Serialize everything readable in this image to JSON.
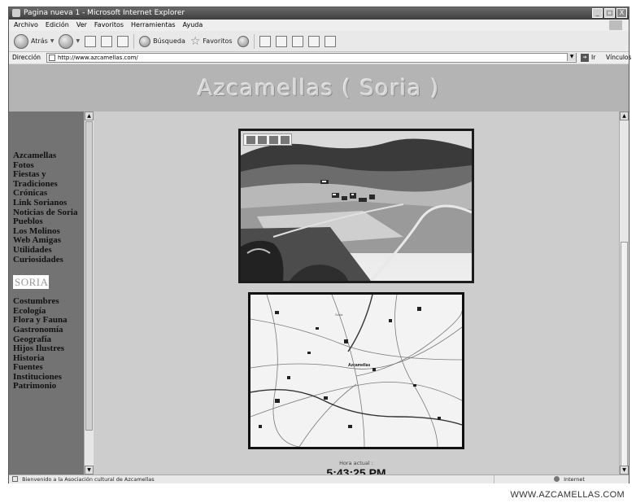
{
  "window": {
    "title": "Pagina nueva 1 - Microsoft Internet Explorer",
    "controls": [
      "_",
      "□",
      "X"
    ]
  },
  "menubar": {
    "items": [
      "Archivo",
      "Edición",
      "Ver",
      "Favoritos",
      "Herramientas",
      "Ayuda"
    ]
  },
  "toolbar": {
    "back_label": "Atrás",
    "search_label": "Búsqueda",
    "favorites_label": "Favoritos"
  },
  "addressbar": {
    "label": "Dirección",
    "url": "http://www.azcamellas.com/",
    "go_label": "Ir",
    "links_label": "Vínculos"
  },
  "page": {
    "banner_title": "Azcamellas ( Soria )",
    "nav_group1": [
      "Azcamellas",
      "Fotos",
      "Fiestas y",
      "Tradiciones",
      "Crónicas",
      "Link Sorianos",
      "Noticias de Soria",
      "Pueblos",
      "Los Molinos",
      "Web Amigas",
      "Utilidades",
      "Curiosidades"
    ],
    "soria_badge": "SORIA",
    "nav_group2": [
      "Costumbres",
      "Ecología",
      "Flora y Fauna",
      "Gastronomía",
      "Geografía",
      "Hijos Ilustres",
      "Historia",
      "Fuentes",
      "Instituciones",
      "Patrimonio"
    ],
    "map_labels": [
      "Azcamellas",
      "Soria"
    ],
    "clock_label": "Hora actual :",
    "clock_time": "5:43:25 PM"
  },
  "statusbar": {
    "message": "Bienvenido a la Asociación cultural de Azcamellas",
    "zone": "Internet"
  },
  "watermark": "WWW.AZCAMELLAS.COM"
}
